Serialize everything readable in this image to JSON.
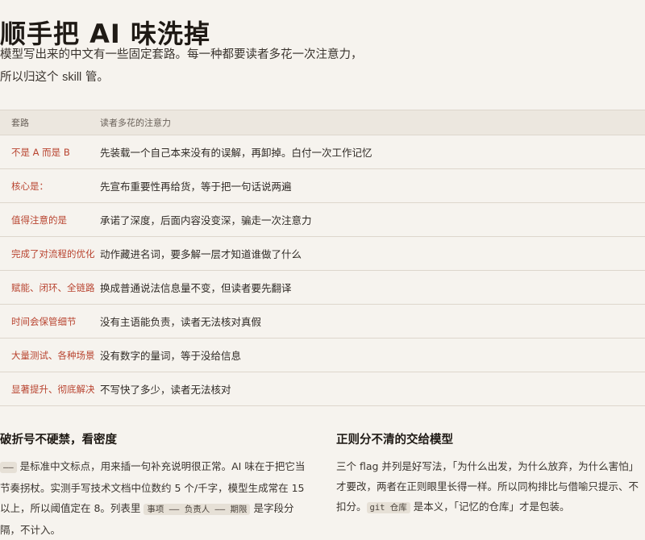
{
  "title": "顺手把 AI 味洗掉",
  "intro": {
    "text_before": "模型写出来的中文有一些固定套路。每一种都要读者多花一次注意力，所以归这个 ",
    "skill_word": "skill",
    "text_after": " 管。"
  },
  "table": {
    "headers": [
      "套路",
      "读者多花的注意力"
    ],
    "rows": [
      {
        "pattern": "不是 A 而是 B",
        "cost": "先装载一个自己本来没有的误解，再卸掉。白付一次工作记忆"
      },
      {
        "pattern": "核心是：",
        "cost": "先宣布重要性再给货，等于把一句话说两遍"
      },
      {
        "pattern": "值得注意的是",
        "cost": "承诺了深度，后面内容没变深，骗走一次注意力"
      },
      {
        "pattern": "完成了对流程的优化",
        "cost": "动作藏进名词，要多解一层才知道谁做了什么"
      },
      {
        "pattern": "赋能、闭环、全链路",
        "cost": "换成普通说法信息量不变，但读者要先翻译"
      },
      {
        "pattern": "时间会保管细节",
        "cost": "没有主语能负责，读者无法核对真假"
      },
      {
        "pattern": "大量测试、各种场景",
        "cost": "没有数字的量词，等于没给信息"
      },
      {
        "pattern": "显著提升、彻底解决",
        "cost": "不写快了多少，读者无法核对"
      }
    ]
  },
  "sections": {
    "left": {
      "heading": "破折号不硬禁，看密度",
      "code_dash": "——",
      "text1": " 是标准中文标点，用来插一句补充说明很正常。AI 味在于把它当节奏拐杖。实测手写技术文档中位数约 5 个/千字，模型生成常在 15 以上，所以阈值定在 8。列表里 ",
      "code_example": "事项 —— 负责人 —— 期限",
      "text2": " 是字段分隔，不计入。"
    },
    "right": {
      "heading": "正则分不清的交给模型",
      "text1": "三个 flag 并列是好写法，「为什么出发，为什么放弃，为什么害怕」才要改，两者在正则眼里长得一样。所以同构排比与借喻只提示、不扣分。",
      "code_example": "git 仓库",
      "text2": " 是本义，「记忆的仓库」才是包装。"
    }
  }
}
